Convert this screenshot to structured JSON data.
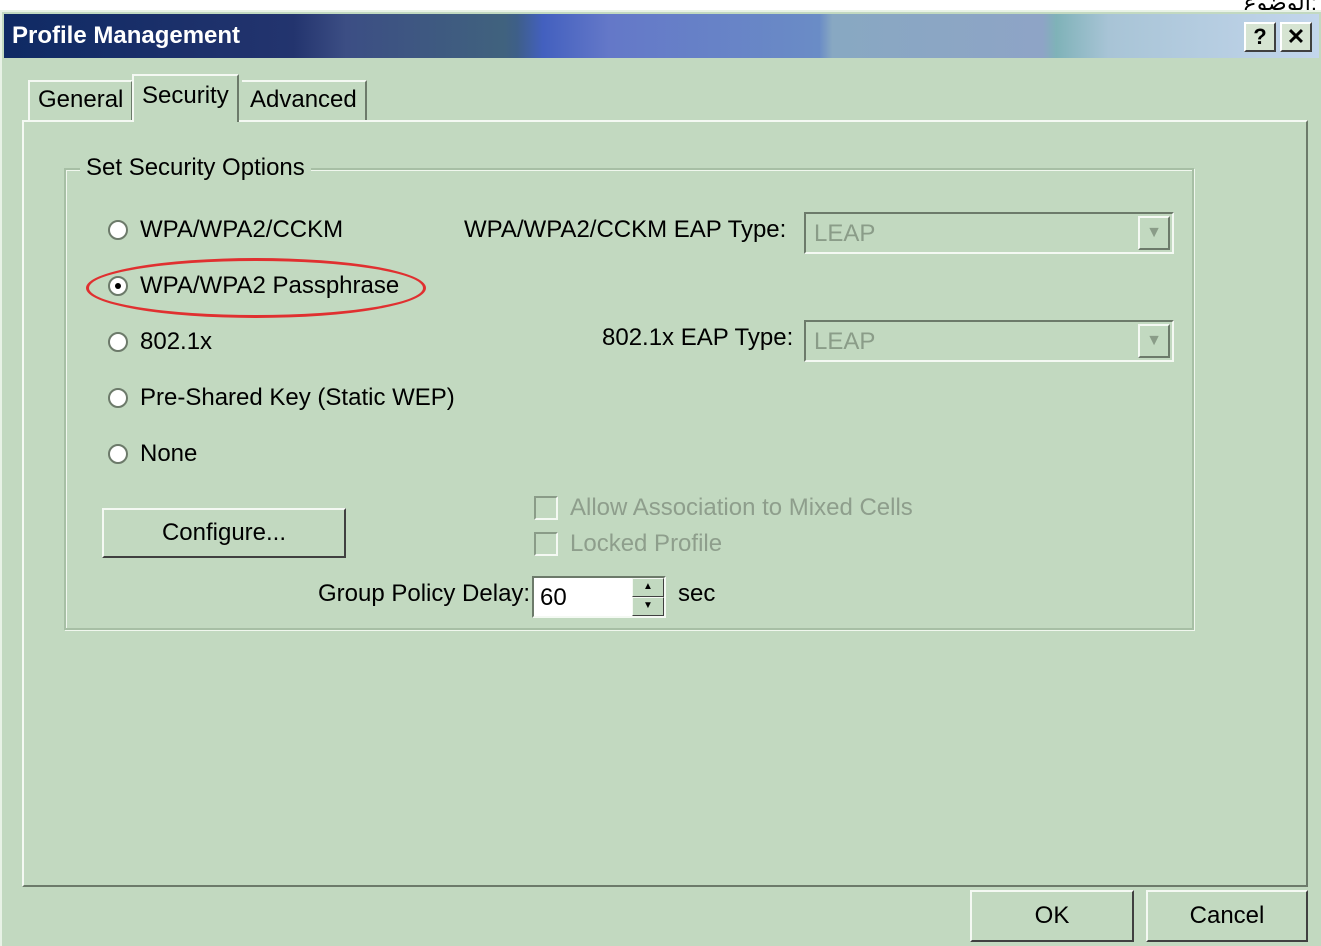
{
  "corner_text": "الوضوع:",
  "window": {
    "title": "Profile Management",
    "help_label": "?",
    "close_label": "✕"
  },
  "tabs": [
    {
      "label": "General",
      "active": false
    },
    {
      "label": "Security",
      "active": true
    },
    {
      "label": "Advanced",
      "active": false
    }
  ],
  "security": {
    "group_title": "Set Security Options",
    "options": [
      {
        "label": "WPA/WPA2/CCKM",
        "checked": false
      },
      {
        "label": "WPA/WPA2 Passphrase",
        "checked": true
      },
      {
        "label": "802.1x",
        "checked": false
      },
      {
        "label": "Pre-Shared Key (Static WEP)",
        "checked": false
      },
      {
        "label": "None",
        "checked": false
      }
    ],
    "wpa_eap_label": "WPA/WPA2/CCKM EAP Type:",
    "wpa_eap_value": "LEAP",
    "eap_8021x_label": "802.1x EAP Type:",
    "eap_8021x_value": "LEAP",
    "configure_label": "Configure...",
    "allow_mixed_label": "Allow Association to Mixed Cells",
    "locked_profile_label": "Locked Profile",
    "group_policy_label": "Group Policy Delay:",
    "group_policy_value": "60",
    "group_policy_unit": "sec"
  },
  "buttons": {
    "ok": "OK",
    "cancel": "Cancel"
  },
  "colors": {
    "dialog_bg": "#c2d9c0",
    "highlight": "#e03030"
  }
}
